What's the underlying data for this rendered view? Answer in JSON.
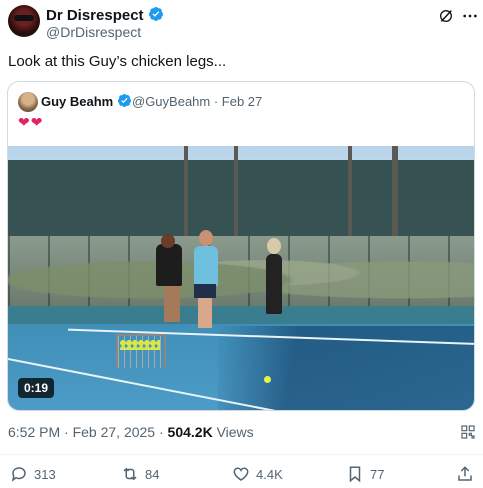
{
  "tweet": {
    "author_name": "Dr Disrespect",
    "author_handle": "@DrDisrespect",
    "text": "Look at this Guy’s chicken legs...",
    "timestamp": "6:52 PM · Feb 27, 2025 · ",
    "views_count": "504.2K",
    "views_label": " Views"
  },
  "quote": {
    "author_name": "Guy Beahm",
    "author_handle": "@GuyBeahm",
    "separator": " · ",
    "date": "Feb 27",
    "text": "❤❤",
    "video_time": "0:19"
  },
  "actions": {
    "replies": "313",
    "reposts": "84",
    "likes": "4.4K",
    "bookmarks": "77"
  },
  "colors": {
    "verified": "#1d9bf0",
    "secondary_text": "#536471",
    "heart": "#e0245e"
  },
  "icons": [
    "verified-badge-icon",
    "grok-icon",
    "more-icon",
    "qr-icon",
    "reply-icon",
    "repost-icon",
    "like-icon",
    "bookmark-icon",
    "share-icon"
  ]
}
